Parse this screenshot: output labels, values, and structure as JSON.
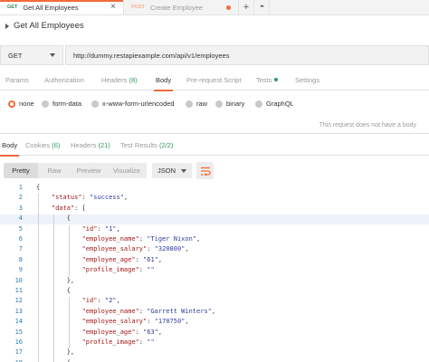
{
  "tabs": [
    {
      "method": "GET",
      "title": "Get All Employees",
      "close": "×"
    },
    {
      "method": "POST",
      "title": "Create Employee"
    }
  ],
  "tab_actions": {
    "add": "+",
    "more": "•••"
  },
  "request": {
    "name": "Get All Employees",
    "method": "GET",
    "url": "http://dummy.restapiexample.com/api/v1/employees"
  },
  "request_tabs": [
    {
      "label": "Params"
    },
    {
      "label": "Authorization"
    },
    {
      "label": "Headers",
      "count": "(8)"
    },
    {
      "label": "Body"
    },
    {
      "label": "Pre-request Script"
    },
    {
      "label": "Tests"
    },
    {
      "label": "Settings"
    }
  ],
  "body_types": [
    "none",
    "form-data",
    "x-www-form-urlencoded",
    "raw",
    "binary",
    "GraphQL"
  ],
  "no_body_message": "This request does not have a body",
  "response_tabs": [
    {
      "label": "Body"
    },
    {
      "label": "Cookies",
      "count": "(6)"
    },
    {
      "label": "Headers",
      "count": "(21)"
    },
    {
      "label": "Test Results",
      "count": "(2/2)"
    }
  ],
  "view_modes": [
    "Pretty",
    "Raw",
    "Preview",
    "Visualize"
  ],
  "format": "JSON",
  "colors": {
    "accent": "#f26b3a",
    "get": "#2e8b57",
    "post": "#f5b28c",
    "success": "#2e9a5f"
  },
  "code_lines": [
    {
      "n": "1",
      "t": [
        {
          "c": "p",
          "v": "{"
        }
      ]
    },
    {
      "n": "2",
      "t": [
        {
          "c": "p",
          "v": "    "
        },
        {
          "c": "k",
          "v": "\"status\""
        },
        {
          "c": "p",
          "v": ": "
        },
        {
          "c": "s",
          "v": "\"success\""
        },
        {
          "c": "p",
          "v": ","
        }
      ]
    },
    {
      "n": "3",
      "t": [
        {
          "c": "p",
          "v": "    "
        },
        {
          "c": "k",
          "v": "\"data\""
        },
        {
          "c": "p",
          "v": ": ["
        }
      ]
    },
    {
      "n": "4",
      "t": [
        {
          "c": "p",
          "v": "        {"
        }
      ]
    },
    {
      "n": "5",
      "t": [
        {
          "c": "p",
          "v": "            "
        },
        {
          "c": "k",
          "v": "\"id\""
        },
        {
          "c": "p",
          "v": ": "
        },
        {
          "c": "s",
          "v": "\"1\""
        },
        {
          "c": "p",
          "v": ","
        }
      ]
    },
    {
      "n": "6",
      "t": [
        {
          "c": "p",
          "v": "            "
        },
        {
          "c": "k",
          "v": "\"employee_name\""
        },
        {
          "c": "p",
          "v": ": "
        },
        {
          "c": "s",
          "v": "\"Tiger Nixon\""
        },
        {
          "c": "p",
          "v": ","
        }
      ]
    },
    {
      "n": "7",
      "t": [
        {
          "c": "p",
          "v": "            "
        },
        {
          "c": "k",
          "v": "\"employee_salary\""
        },
        {
          "c": "p",
          "v": ": "
        },
        {
          "c": "s",
          "v": "\"320800\""
        },
        {
          "c": "p",
          "v": ","
        }
      ]
    },
    {
      "n": "8",
      "t": [
        {
          "c": "p",
          "v": "            "
        },
        {
          "c": "k",
          "v": "\"employee_age\""
        },
        {
          "c": "p",
          "v": ": "
        },
        {
          "c": "s",
          "v": "\"61\""
        },
        {
          "c": "p",
          "v": ","
        }
      ]
    },
    {
      "n": "9",
      "t": [
        {
          "c": "p",
          "v": "            "
        },
        {
          "c": "k",
          "v": "\"profile_image\""
        },
        {
          "c": "p",
          "v": ": "
        },
        {
          "c": "s",
          "v": "\"\""
        }
      ]
    },
    {
      "n": "10",
      "t": [
        {
          "c": "p",
          "v": "        },"
        }
      ]
    },
    {
      "n": "11",
      "t": [
        {
          "c": "p",
          "v": "        {"
        }
      ]
    },
    {
      "n": "12",
      "t": [
        {
          "c": "p",
          "v": "            "
        },
        {
          "c": "k",
          "v": "\"id\""
        },
        {
          "c": "p",
          "v": ": "
        },
        {
          "c": "s",
          "v": "\"2\""
        },
        {
          "c": "p",
          "v": ","
        }
      ]
    },
    {
      "n": "13",
      "t": [
        {
          "c": "p",
          "v": "            "
        },
        {
          "c": "k",
          "v": "\"employee_name\""
        },
        {
          "c": "p",
          "v": ": "
        },
        {
          "c": "s",
          "v": "\"Garrett Winters\""
        },
        {
          "c": "p",
          "v": ","
        }
      ]
    },
    {
      "n": "14",
      "t": [
        {
          "c": "p",
          "v": "            "
        },
        {
          "c": "k",
          "v": "\"employee_salary\""
        },
        {
          "c": "p",
          "v": ": "
        },
        {
          "c": "s",
          "v": "\"170750\""
        },
        {
          "c": "p",
          "v": ","
        }
      ]
    },
    {
      "n": "15",
      "t": [
        {
          "c": "p",
          "v": "            "
        },
        {
          "c": "k",
          "v": "\"employee_age\""
        },
        {
          "c": "p",
          "v": ": "
        },
        {
          "c": "s",
          "v": "\"63\""
        },
        {
          "c": "p",
          "v": ","
        }
      ]
    },
    {
      "n": "16",
      "t": [
        {
          "c": "p",
          "v": "            "
        },
        {
          "c": "k",
          "v": "\"profile_image\""
        },
        {
          "c": "p",
          "v": ": "
        },
        {
          "c": "s",
          "v": "\"\""
        }
      ]
    },
    {
      "n": "17",
      "t": [
        {
          "c": "p",
          "v": "        },"
        }
      ]
    },
    {
      "n": "18",
      "t": [
        {
          "c": "p",
          "v": "        {"
        }
      ]
    }
  ]
}
